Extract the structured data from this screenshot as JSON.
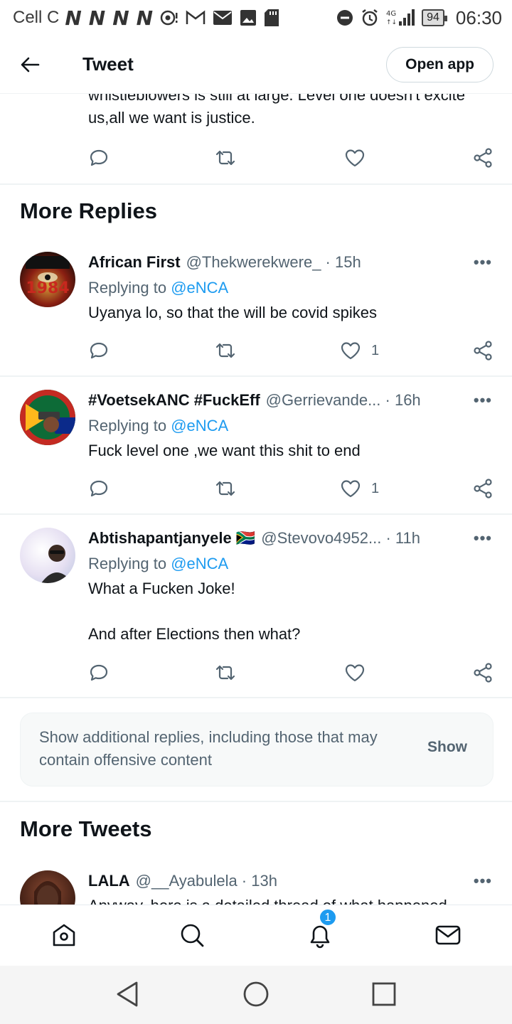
{
  "status_bar": {
    "carrier": "Cell C",
    "battery": "94",
    "time": "06:30",
    "network": "4G"
  },
  "header": {
    "title": "Tweet",
    "open_app": "Open app"
  },
  "top_tweet": {
    "text": "whistleblowers is still at large. Level one doesn't excite us,all we want is justice."
  },
  "more_replies": {
    "title": "More Replies",
    "items": [
      {
        "name": "African First",
        "handle": "@Thekwerekwere_ · 15h",
        "replying_prefix": "Replying to",
        "mention": "@eNCA",
        "text": "Uyanya lo, so that the will be covid spikes",
        "likes": "1",
        "avatar_text": "1984"
      },
      {
        "name": "#VoetsekANC #FuckEff",
        "handle": "@Gerrievande... · 16h",
        "replying_prefix": "Replying to",
        "mention": "@eNCA",
        "text": "Fuck level one ,we want this shit to end",
        "likes": "1"
      },
      {
        "name": "Abtishapantjanyele 🇿🇦",
        "handle": "@Stevovo4952... · 11h",
        "replying_prefix": "Replying to",
        "mention": "@eNCA",
        "text": "What a Fucken Joke!\n\nAnd after Elections then what?",
        "likes": ""
      }
    ]
  },
  "show_more": {
    "text": "Show additional replies, including those that may contain offensive content",
    "button": "Show"
  },
  "more_tweets": {
    "title": "More Tweets",
    "items": [
      {
        "name": "LALA",
        "handle": "@__Ayabulela · 13h",
        "text": "Anyway, here is a detailed thread of what happened"
      }
    ]
  },
  "bottom_nav": {
    "notifications_badge": "1"
  },
  "colors": {
    "accent": "#1d9bf0",
    "secondary_text": "#536471",
    "primary_text": "#0f1419"
  }
}
